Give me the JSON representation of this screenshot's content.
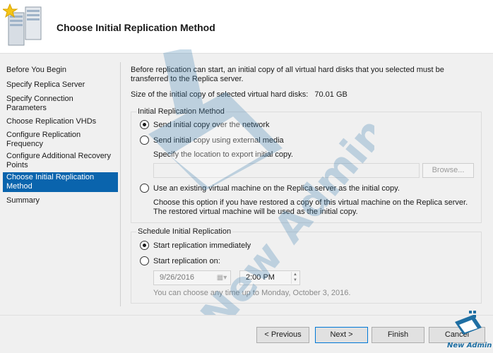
{
  "header": {
    "title": "Choose Initial Replication Method"
  },
  "sidebar": {
    "items": [
      {
        "label": "Before You Begin",
        "active": false
      },
      {
        "label": "Specify Replica Server",
        "active": false
      },
      {
        "label": "Specify Connection Parameters",
        "active": false
      },
      {
        "label": "Choose Replication VHDs",
        "active": false
      },
      {
        "label": "Configure Replication Frequency",
        "active": false
      },
      {
        "label": "Configure Additional Recovery Points",
        "active": false
      },
      {
        "label": "Choose Initial Replication Method",
        "active": true
      },
      {
        "label": "Summary",
        "active": false
      }
    ]
  },
  "main": {
    "intro": "Before replication can start, an initial copy of all virtual hard disks that you selected must be transferred to the Replica server.",
    "size_label": "Size of the initial copy of selected virtual hard disks:",
    "size_value": "70.01 GB",
    "method_group": {
      "title": "Initial Replication Method",
      "options": [
        {
          "label": "Send initial copy over the network",
          "checked": true
        },
        {
          "label": "Send initial copy using external media",
          "checked": false
        },
        {
          "label": "Use an existing virtual machine on the Replica server as the initial copy.",
          "checked": false
        }
      ],
      "export_hint": "Specify the location to export initial copy.",
      "export_path": "",
      "browse_label": "Browse...",
      "existing_vm_hint": "Choose this option if you have restored a copy of this virtual machine on the Replica server. The restored virtual machine will be used as the initial copy."
    },
    "schedule_group": {
      "title": "Schedule Initial Replication",
      "options": [
        {
          "label": "Start replication immediately",
          "checked": true
        },
        {
          "label": "Start replication on:",
          "checked": false
        }
      ],
      "date": "9/26/2016",
      "time": "2:00 PM",
      "hint": "You can choose any time up to Monday, October 3, 2016."
    }
  },
  "footer": {
    "previous": "< Previous",
    "next": "Next >",
    "finish": "Finish",
    "cancel": "Cancel"
  },
  "branding": {
    "watermark": "New Admin",
    "logo_text": "New Admin"
  },
  "colors": {
    "selection": "#0a64ad",
    "accent": "#0078d7",
    "watermark": "#3c7fb0"
  }
}
